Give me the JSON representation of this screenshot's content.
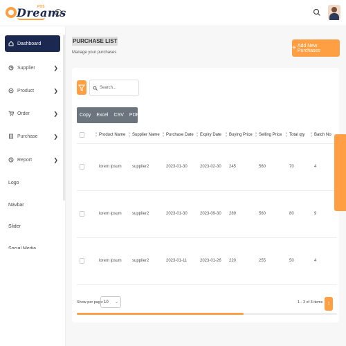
{
  "header": {
    "logo_text": "Dreams",
    "logo_badge": "POS",
    "icons": [
      "toggle-sidebar-icon",
      "search-icon",
      "user-avatar"
    ]
  },
  "sidebar": {
    "items": [
      {
        "label": "Dashboard",
        "icon": "dashboard-icon",
        "active": true
      },
      {
        "label": "Supplier",
        "icon": "supplier-icon",
        "chevron": "❯"
      },
      {
        "label": "Product",
        "icon": "product-icon",
        "chevron": "❯"
      },
      {
        "label": "Order",
        "icon": "cart-icon",
        "chevron": "❯"
      },
      {
        "label": "Purchase",
        "icon": "purchase-icon",
        "chevron": "❯"
      },
      {
        "label": "Report",
        "icon": "report-icon",
        "chevron": "❯"
      }
    ],
    "plain_items": [
      "Logo",
      "Navbar",
      "Slider",
      "Social Media"
    ]
  },
  "page": {
    "title": "PURCHASE LIST",
    "subtitle": "Manage your purchases",
    "add_button": "Add New Purchases",
    "add_icon": "+"
  },
  "toolbar": {
    "search_placeholder": "Search...",
    "export_buttons": [
      "Copy",
      "Excel",
      "CSV",
      "PDF"
    ]
  },
  "table": {
    "columns": [
      "Product Name",
      "Supplier Name",
      "Purchase Date",
      "Expiry Date",
      "Buying Price",
      "Selling Price",
      "Total qty",
      "Batch No"
    ],
    "rows": [
      [
        "lorem ipsum",
        "supplier2",
        "2023-01-30",
        "2023-02-30",
        "245",
        "560",
        "70",
        "4"
      ],
      [
        "lorem ipsum",
        "supplier2",
        "2023-01-30",
        "2023-09-30",
        "289",
        "560",
        "80",
        "9"
      ],
      [
        "lorem ipsum",
        "supplier2",
        "2023-01-11",
        "2023-01-26",
        "220",
        "255",
        "50",
        "4"
      ]
    ]
  },
  "pagination": {
    "per_page_label": "Show per page:",
    "per_page_value": "10",
    "range_text": "1 - 3 of 3 items",
    "current_page": "1"
  },
  "colors": {
    "accent": "#ff9f43",
    "sidebar_active": "#1b2850",
    "export_bar": "#6c757d"
  }
}
